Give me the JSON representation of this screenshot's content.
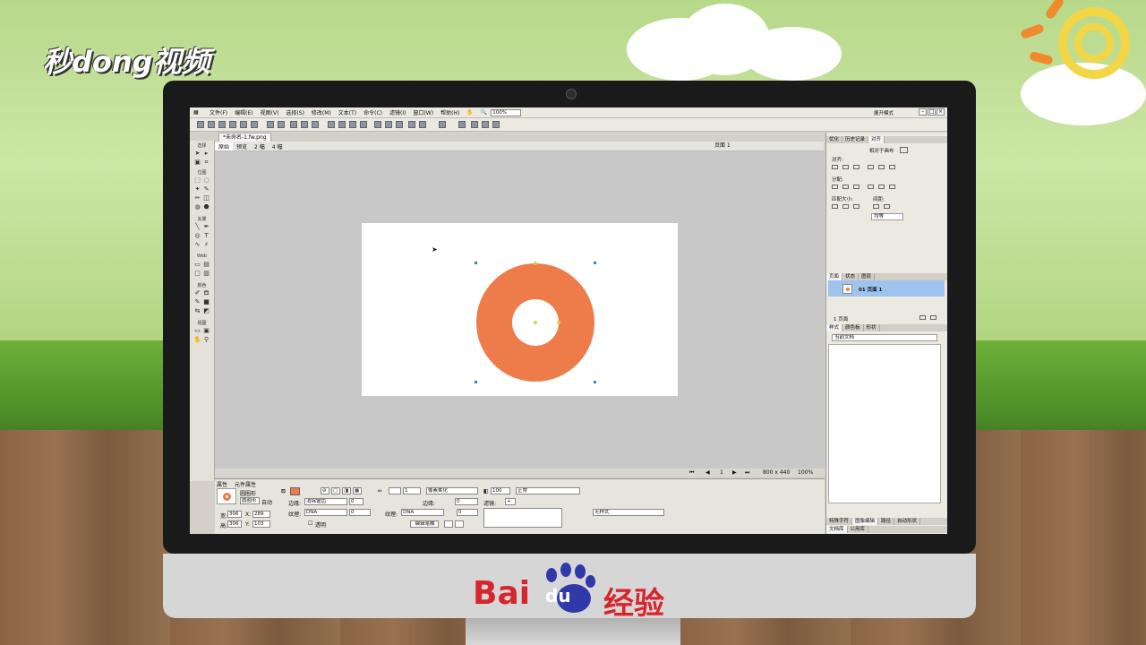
{
  "brand": {
    "watermark": "秒dong视频",
    "footer_brand": "Bai",
    "footer_du": "du",
    "footer_suffix": "经验"
  },
  "app": {
    "menu": [
      "文件(F)",
      "编辑(E)",
      "视图(V)",
      "选择(S)",
      "修改(M)",
      "文本(T)",
      "命令(C)",
      "滤镜(I)",
      "窗口(W)",
      "帮助(H)"
    ],
    "zoom_top": "100%",
    "workspace": "展开模式",
    "doc_tab": "*未命名-1.fw.png",
    "views": [
      "原始",
      "预览",
      "2 幅",
      "4 幅"
    ],
    "page_select": "页面 1",
    "toolbox_sections": [
      "选择",
      "位图",
      "矢量",
      "Web",
      "颜色",
      "视图"
    ],
    "status": {
      "page_num": "1",
      "size": "800 x 440",
      "zoom": "100%"
    }
  },
  "props": {
    "tabs": [
      "属性",
      "元件属性"
    ],
    "object_type": "圆圈形",
    "object_name": "圆圈形",
    "auto_btn": "自动",
    "w_label": "宽:",
    "w": "306",
    "h_label": "高:",
    "h": "306",
    "x_label": "X:",
    "x": "289",
    "y_label": "Y:",
    "y": "103",
    "edge_label": "边缘:",
    "edge_value": "消除锯齿",
    "edge_num": "0",
    "texture_label": "纹理:",
    "texture_value": "DNA",
    "texture_num": "0",
    "transparent_label": "透明",
    "stroke_size": "1",
    "stroke_type": "像素柔化",
    "stroke_edge_label": "边缘:",
    "stroke_edge_num": "0",
    "stroke_texture_label": "纹理:",
    "stroke_texture_value": "DNA",
    "stroke_texture_num": "0",
    "edit_stroke_btn": "编辑笔触",
    "opacity": "100",
    "blend_mode": "正常",
    "filters_label": "滤镜:",
    "style_value": "无样式"
  },
  "right_panel": {
    "top_tabs": [
      "优化",
      "历史记录",
      "对齐"
    ],
    "relative_label": "相对于画布",
    "align_label": "对齐:",
    "distribute_label": "分配:",
    "match_label": "匹配大小:",
    "spacing_label": "间距:",
    "spacing_value": "均等",
    "mid_tabs": [
      "页面",
      "状态",
      "图层"
    ],
    "page_entry": "01 页面 1",
    "page_footer": "1 页面",
    "lower_tabs": [
      "样式",
      "颜色板",
      "形状"
    ],
    "current_doc": "当前文档",
    "bottom_tabs": [
      "特殊字符",
      "图像编辑",
      "路径",
      "自动形状"
    ],
    "bottom_tabs2": [
      "文档库",
      "公用库"
    ]
  },
  "colors": {
    "shape_fill": "#ee7c4a",
    "canvas_bg": "#c8c8c8"
  }
}
